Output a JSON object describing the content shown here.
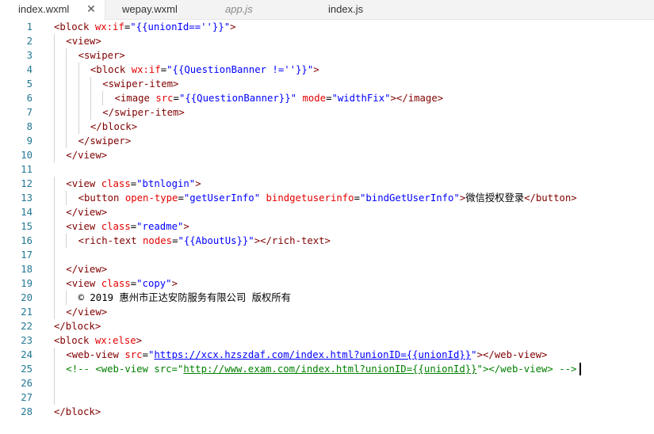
{
  "tabs": [
    {
      "label": "index.wxml",
      "active": true,
      "close_icon": "close-icon"
    },
    {
      "label": "wepay.wxml",
      "active": false
    },
    {
      "label": "app.js",
      "active": false,
      "preview": true
    },
    {
      "label": "index.js",
      "active": false
    }
  ],
  "lines": [
    {
      "n": "1",
      "indent": 0,
      "tokens": [
        [
          "t",
          "<block "
        ],
        [
          "a",
          "wx:if"
        ],
        [
          "p",
          "="
        ],
        [
          "s",
          "\"{{unionId==''}}\""
        ],
        [
          "t",
          ">"
        ]
      ]
    },
    {
      "n": "2",
      "indent": 1,
      "tokens": [
        [
          "t",
          "<view>"
        ]
      ]
    },
    {
      "n": "3",
      "indent": 2,
      "tokens": [
        [
          "t",
          "<swiper>"
        ]
      ]
    },
    {
      "n": "4",
      "indent": 3,
      "tokens": [
        [
          "t",
          "<block "
        ],
        [
          "a",
          "wx:if"
        ],
        [
          "p",
          "="
        ],
        [
          "s",
          "\"{{QuestionBanner !=''}}\""
        ],
        [
          "t",
          ">"
        ]
      ]
    },
    {
      "n": "5",
      "indent": 4,
      "tokens": [
        [
          "t",
          "<swiper-item>"
        ]
      ]
    },
    {
      "n": "6",
      "indent": 5,
      "tokens": [
        [
          "t",
          "<image "
        ],
        [
          "a",
          "src"
        ],
        [
          "p",
          "="
        ],
        [
          "s",
          "\"{{QuestionBanner}}\""
        ],
        [
          "p",
          " "
        ],
        [
          "a",
          "mode"
        ],
        [
          "p",
          "="
        ],
        [
          "s",
          "\"widthFix\""
        ],
        [
          "t",
          "></image>"
        ]
      ]
    },
    {
      "n": "7",
      "indent": 4,
      "tokens": [
        [
          "t",
          "</swiper-item>"
        ]
      ]
    },
    {
      "n": "8",
      "indent": 3,
      "tokens": [
        [
          "t",
          "</block>"
        ]
      ]
    },
    {
      "n": "9",
      "indent": 2,
      "tokens": [
        [
          "t",
          "</swiper>"
        ]
      ]
    },
    {
      "n": "10",
      "indent": 1,
      "tokens": [
        [
          "t",
          "</view>"
        ]
      ]
    },
    {
      "n": "11",
      "indent": 0,
      "tokens": []
    },
    {
      "n": "12",
      "indent": 1,
      "tokens": [
        [
          "t",
          "<view "
        ],
        [
          "a",
          "class"
        ],
        [
          "p",
          "="
        ],
        [
          "s",
          "\"btnlogin\""
        ],
        [
          "t",
          ">"
        ]
      ]
    },
    {
      "n": "13",
      "indent": 2,
      "tokens": [
        [
          "t",
          "<button "
        ],
        [
          "a",
          "open-type"
        ],
        [
          "p",
          "="
        ],
        [
          "s",
          "\"getUserInfo\""
        ],
        [
          "p",
          " "
        ],
        [
          "a",
          "bindgetuserinfo"
        ],
        [
          "p",
          "="
        ],
        [
          "s",
          "\"bindGetUserInfo\""
        ],
        [
          "t",
          ">"
        ],
        [
          "p",
          "微信授权登录"
        ],
        [
          "t",
          "</button>"
        ]
      ]
    },
    {
      "n": "14",
      "indent": 1,
      "tokens": [
        [
          "t",
          "</view>"
        ]
      ]
    },
    {
      "n": "15",
      "indent": 1,
      "tokens": [
        [
          "t",
          "<view "
        ],
        [
          "a",
          "class"
        ],
        [
          "p",
          "="
        ],
        [
          "s",
          "\"readme\""
        ],
        [
          "t",
          ">"
        ]
      ]
    },
    {
      "n": "16",
      "indent": 2,
      "tokens": [
        [
          "t",
          "<rich-text "
        ],
        [
          "a",
          "nodes"
        ],
        [
          "p",
          "="
        ],
        [
          "s",
          "\"{{AboutUs}}\""
        ],
        [
          "t",
          "></rich-text>"
        ]
      ]
    },
    {
      "n": "17",
      "indent": 0,
      "guides": 1,
      "tokens": []
    },
    {
      "n": "18",
      "indent": 1,
      "tokens": [
        [
          "t",
          "</view>"
        ]
      ]
    },
    {
      "n": "19",
      "indent": 1,
      "tokens": [
        [
          "t",
          "<view "
        ],
        [
          "a",
          "class"
        ],
        [
          "p",
          "="
        ],
        [
          "s",
          "\"copy\""
        ],
        [
          "t",
          ">"
        ]
      ]
    },
    {
      "n": "20",
      "indent": 2,
      "tokens": [
        [
          "p",
          "© 2019 惠州市正达安防服务有限公司 版权所有"
        ]
      ]
    },
    {
      "n": "21",
      "indent": 1,
      "tokens": [
        [
          "t",
          "</view>"
        ]
      ]
    },
    {
      "n": "22",
      "indent": 0,
      "tokens": [
        [
          "t",
          "</block>"
        ]
      ]
    },
    {
      "n": "23",
      "indent": 0,
      "tokens": [
        [
          "t",
          "<block "
        ],
        [
          "a",
          "wx:else"
        ],
        [
          "t",
          ">"
        ]
      ]
    },
    {
      "n": "24",
      "indent": 1,
      "tokens": [
        [
          "t",
          "<web-view "
        ],
        [
          "a",
          "src"
        ],
        [
          "p",
          "="
        ],
        [
          "s",
          "\""
        ],
        [
          "su",
          "https://xcx.hzszdaf.com/index.html?unionID={{unionId}}"
        ],
        [
          "s",
          "\""
        ],
        [
          "t",
          "></web-view>"
        ]
      ]
    },
    {
      "n": "25",
      "indent": 1,
      "tokens": [
        [
          "c",
          "<!-- <web-view src=\""
        ],
        [
          "cu",
          "http://www.exam.com/index.html?unionID={{unionId}}"
        ],
        [
          "c",
          "\"></web-view> -->"
        ]
      ],
      "cursor": true
    },
    {
      "n": "26",
      "indent": 0,
      "guides": 1,
      "tokens": []
    },
    {
      "n": "27",
      "indent": 0,
      "guides": 1,
      "tokens": []
    },
    {
      "n": "28",
      "indent": 0,
      "tokens": [
        [
          "t",
          "</block>"
        ]
      ]
    }
  ]
}
